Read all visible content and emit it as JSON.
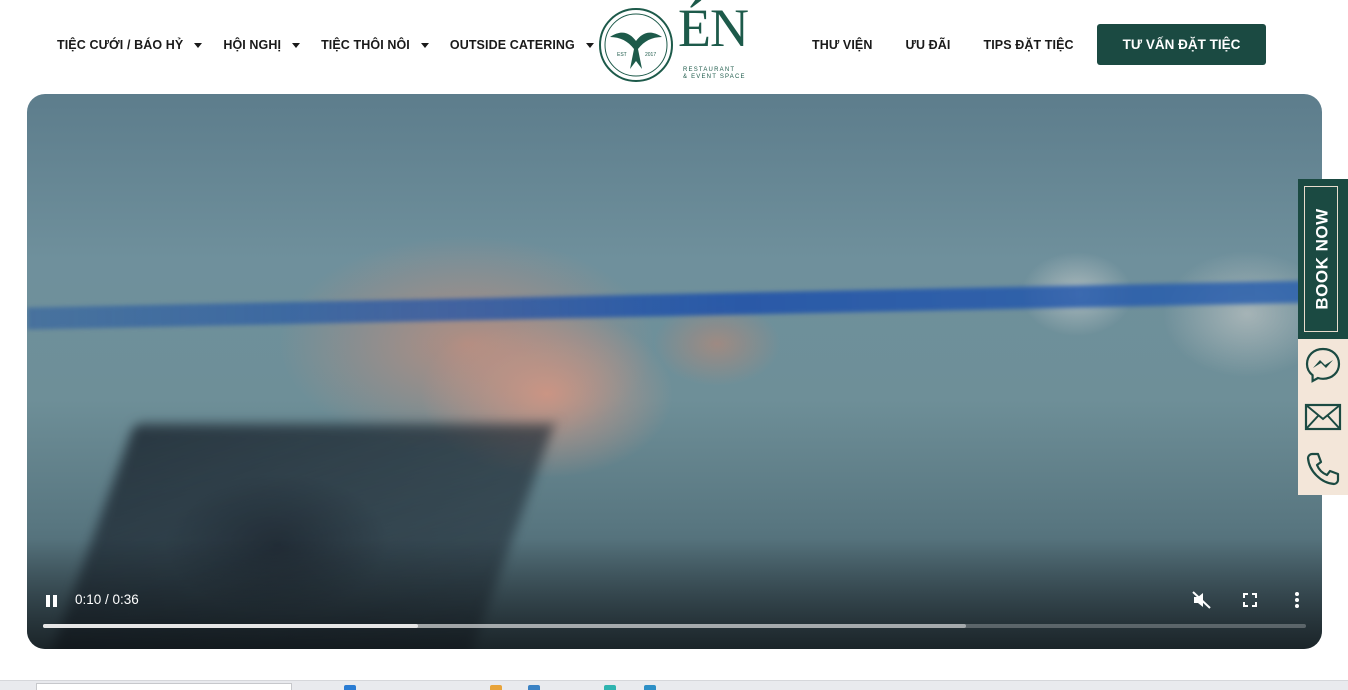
{
  "nav": {
    "left": [
      {
        "label": "TIỆC CƯỚI / BÁO HỶ"
      },
      {
        "label": "HỘI NGHỊ"
      },
      {
        "label": "TIỆC THÔI NÔI"
      },
      {
        "label": "OUTSIDE CATERING"
      }
    ],
    "right": [
      {
        "label": "THƯ VIỆN"
      },
      {
        "label": "ƯU ĐÃI"
      },
      {
        "label": "TIPS ĐẶT TIỆC"
      }
    ]
  },
  "logo": {
    "wordmark": "ÉN",
    "subtitle_line1": "RESTAURANT",
    "subtitle_line2": "& EVENT SPACE",
    "emblem_left": "EST",
    "emblem_right": "2017"
  },
  "cta": {
    "label": "TƯ VẤN ĐẶT TIỆC"
  },
  "video": {
    "current_time": "0:10",
    "duration": "0:36",
    "time_display": "0:10 / 0:36",
    "played_fraction": 0.2969,
    "buffered_fraction": 0.7308,
    "muted": true,
    "playing": true
  },
  "side_widget": {
    "book_now": "BOOK NOW",
    "icons": [
      "messenger-icon",
      "mail-icon",
      "phone-icon"
    ]
  },
  "colors": {
    "brand": "#1b4a42",
    "logo": "#1d5a4a",
    "side_bg": "#f3e6d9",
    "text": "#1a1a1a"
  }
}
